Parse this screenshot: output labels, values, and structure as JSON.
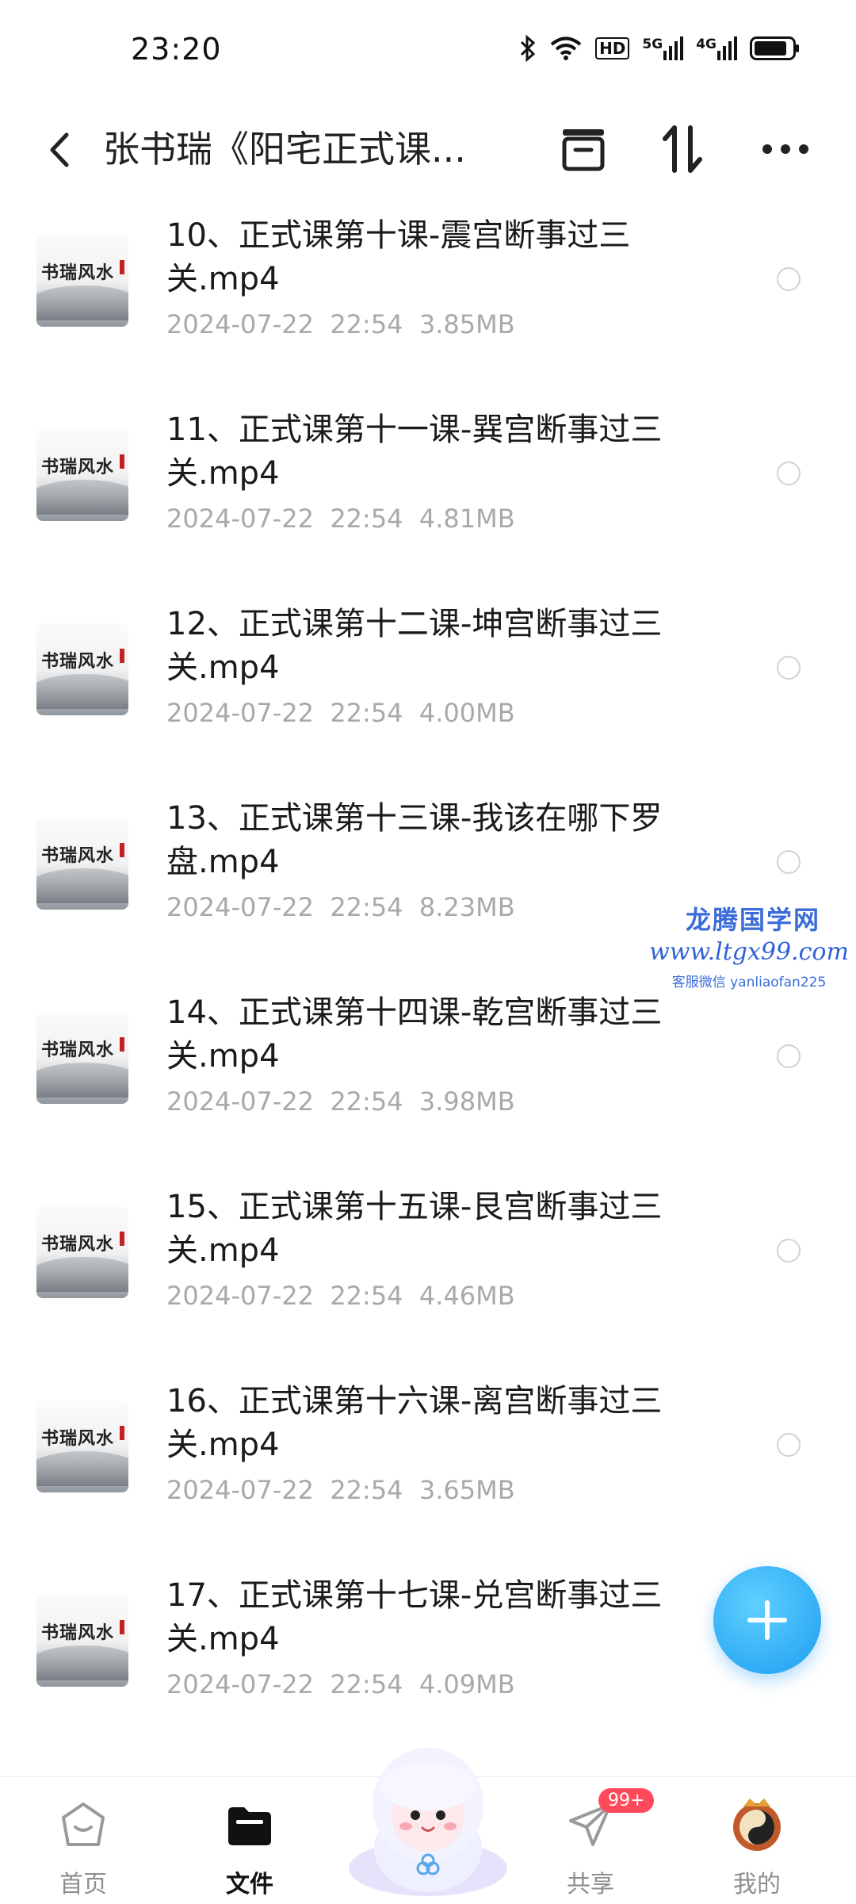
{
  "status": {
    "time": "23:20",
    "hd_label": "HD",
    "net5g": "5G",
    "net4g": "4G"
  },
  "header": {
    "title": "张书瑞《阳宅正式课..."
  },
  "thumb": {
    "brand": "书瑞风水"
  },
  "files": [
    {
      "name": "10、正式课第十课-震宫断事过三关.mp4",
      "date": "2024-07-22  22:54",
      "size": "3.85MB"
    },
    {
      "name": "11、正式课第十一课-巽宫断事过三关.mp4",
      "date": "2024-07-22  22:54",
      "size": "4.81MB"
    },
    {
      "name": "12、正式课第十二课-坤宫断事过三关.mp4",
      "date": "2024-07-22  22:54",
      "size": "4.00MB"
    },
    {
      "name": "13、正式课第十三课-我该在哪下罗盘.mp4",
      "date": "2024-07-22  22:54",
      "size": "8.23MB"
    },
    {
      "name": "14、正式课第十四课-乾宫断事过三关.mp4",
      "date": "2024-07-22  22:54",
      "size": "3.98MB"
    },
    {
      "name": "15、正式课第十五课-艮宫断事过三关.mp4",
      "date": "2024-07-22  22:54",
      "size": "4.46MB"
    },
    {
      "name": "16、正式课第十六课-离宫断事过三关.mp4",
      "date": "2024-07-22  22:54",
      "size": "3.65MB"
    },
    {
      "name": "17、正式课第十七课-兑宫断事过三关.mp4",
      "date": "2024-07-22  22:54",
      "size": "4.09MB"
    }
  ],
  "watermark": {
    "title": "龙腾国学网",
    "url": "www.ltgx99.com",
    "contact": "客服微信 yanliaofan225"
  },
  "nav": {
    "home": "首页",
    "files": "文件",
    "share": "共享",
    "share_badge": "99+",
    "mine": "我的"
  },
  "colors": {
    "accent": "#1d9df0",
    "badge": "#ff4a5c",
    "meta_text": "#a9a9a9"
  }
}
